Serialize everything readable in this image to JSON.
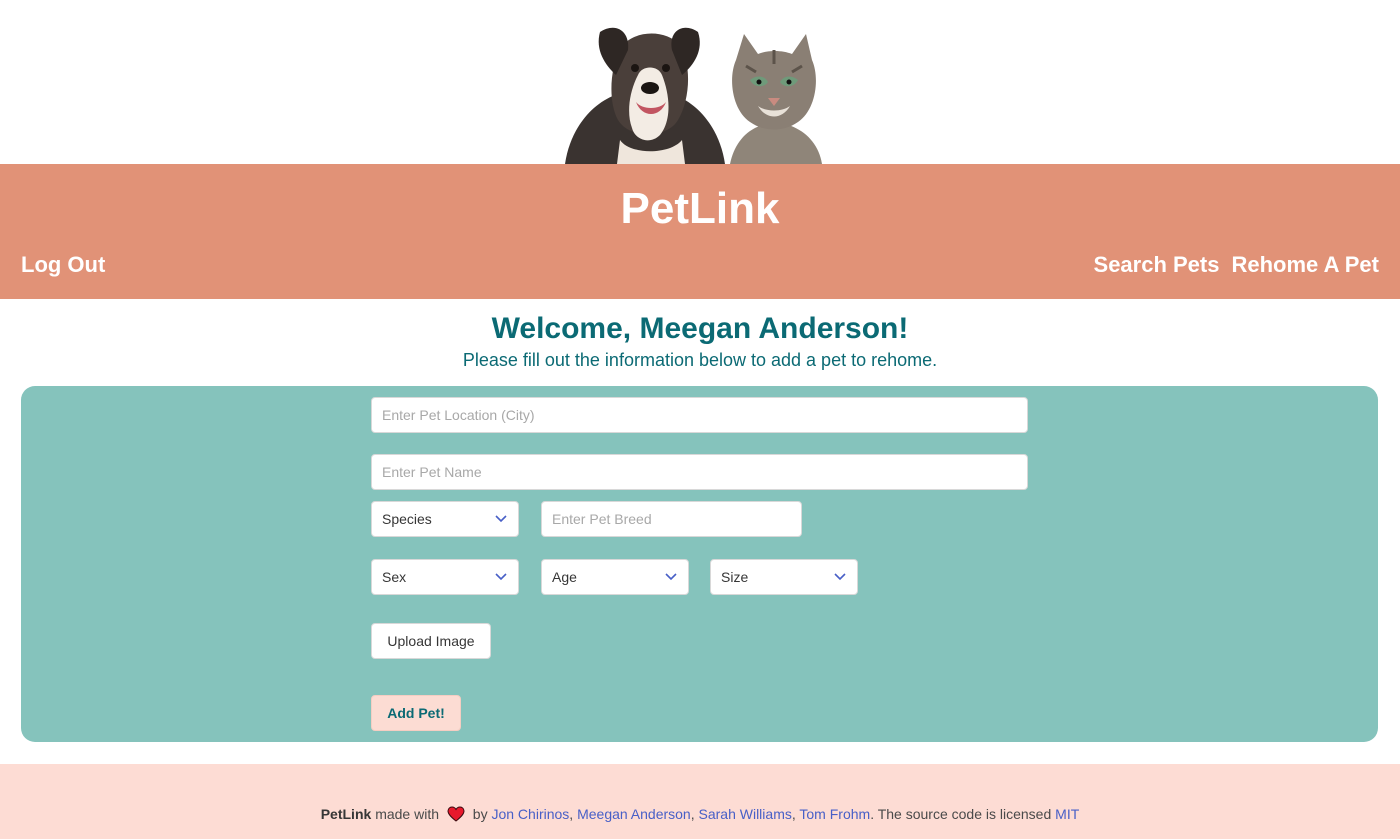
{
  "hero": {
    "image_alt": "dog and cat banner"
  },
  "brand": {
    "title": "PetLink"
  },
  "nav": {
    "logout": "Log Out",
    "search": "Search Pets",
    "rehome": "Rehome A Pet"
  },
  "welcome": {
    "title": "Welcome, Meegan Anderson!",
    "subtitle": "Please fill out the information below to add a pet to rehome."
  },
  "form": {
    "location_placeholder": "Enter Pet Location (City)",
    "name_placeholder": "Enter Pet Name",
    "species_label": "Species",
    "breed_placeholder": "Enter Pet Breed",
    "sex_label": "Sex",
    "age_label": "Age",
    "size_label": "Size",
    "upload_label": "Upload Image",
    "submit_label": "Add Pet!"
  },
  "footer": {
    "brand": "PetLink",
    "made_with": "made with",
    "by": "by",
    "authors": [
      "Jon Chirinos",
      "Meegan Anderson",
      "Sarah Williams",
      "Tom Frohm"
    ],
    "license_text": ". The source code is licensed",
    "license": "MIT"
  },
  "colors": {
    "navbar": "#e19277",
    "accent_text": "#0b6a74",
    "form_panel": "#85c3bc",
    "footer_bg": "#fddcd4",
    "link": "#485fc7",
    "heart": "#e8192c"
  },
  "icons": {
    "select_chevron": "chevron-down-icon",
    "heart": "heart-icon"
  }
}
